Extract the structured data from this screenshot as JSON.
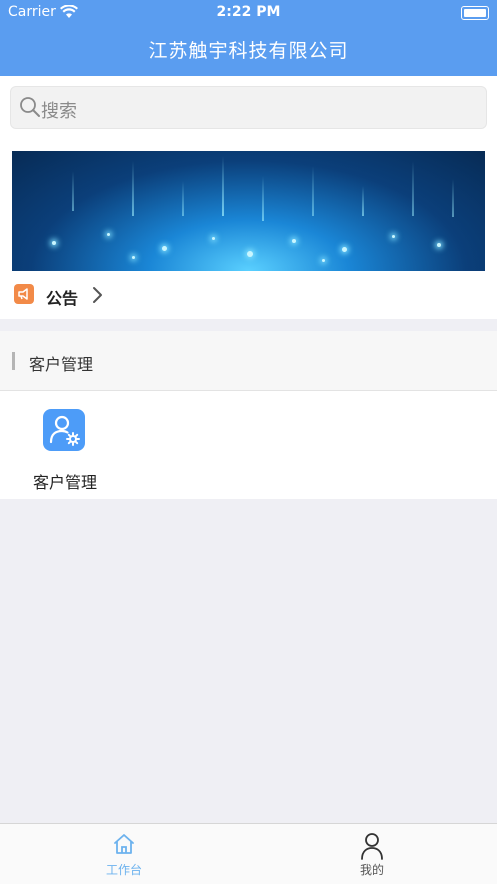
{
  "status_bar": {
    "carrier": "Carrier",
    "time": "2:22 PM"
  },
  "header": {
    "title": "江苏触宇科技有限公司"
  },
  "search": {
    "placeholder": "搜索"
  },
  "notice": {
    "label": "公告"
  },
  "section": {
    "title": "客户管理"
  },
  "apps": [
    {
      "label": "客户管理",
      "icon": "user-settings-icon"
    }
  ],
  "tabbar": {
    "items": [
      {
        "label": "工作台",
        "icon": "home-icon",
        "active": true
      },
      {
        "label": "我的",
        "icon": "person-icon",
        "active": false
      }
    ]
  },
  "colors": {
    "accent": "#5a9df0",
    "active_tab": "#6cb2ee",
    "inactive_tab": "#555555",
    "notice_icon": "#f28a48",
    "app_icon": "#4d9cf8"
  }
}
